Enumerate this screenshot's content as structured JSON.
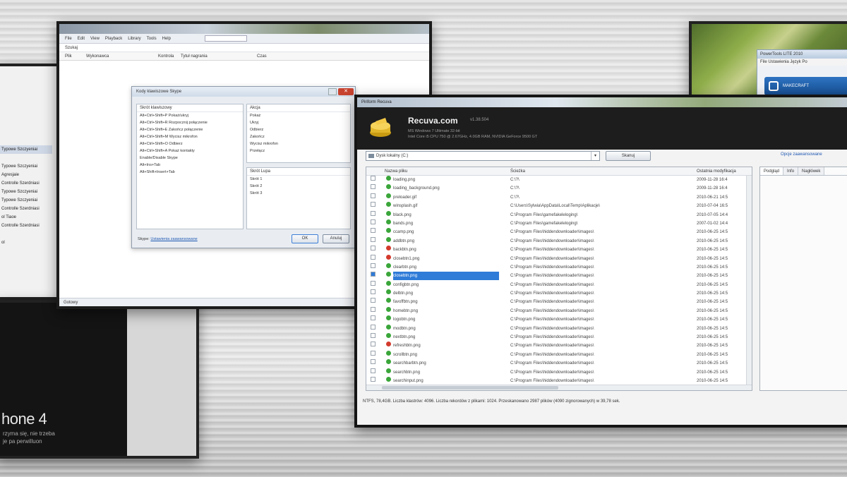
{
  "left_window": {
    "items": [
      "",
      "Typowe Szczyeniai",
      "",
      "Typowe Szczyeniai",
      "Agresjaie",
      "Controlle Szerdniasi",
      "Typowe Szczyeniai",
      "Typowe Szczyeniai",
      "Controlle Szerdniasi",
      "ol Tiaoe",
      "Controlle Szerdniasi",
      "",
      "ol"
    ]
  },
  "phone_window": {
    "title": "hone 4",
    "subtitle_1": "rzyma się, nie trzeba",
    "subtitle_2": "je pa perwilluon"
  },
  "forest_window": {
    "title": "PowerTools LITE 2010",
    "menu": "File   Ustawienia   Język   Po",
    "banner": "MAKECRAFT"
  },
  "media_window": {
    "menu": [
      "File",
      "Edit",
      "View",
      "Playback",
      "Library",
      "Tools",
      "Help"
    ],
    "address": "Szukaj",
    "columns": [
      "Plik",
      "Wykonawca",
      "Kontrola",
      "Tytuł nagrania",
      "Czas"
    ],
    "status": "Gotowy",
    "dialog": {
      "title": "Kody klawiszowe Skype",
      "left_caption": "Skrót klawiszowy",
      "left_items": [
        "Alt+Ctrl+Shift+P Pokaż/ukryj",
        "Alt+Ctrl+Shift+R Rozpocznij połączenie",
        "Alt+Ctrl+Shift+E Zakończ połączenie",
        "Alt+Ctrl+Shift+M Wycisz mikrofon",
        "Alt+Ctrl+Shift+O Odbierz",
        "Alt+Ctrl+Shift+A Pokaż kontakty",
        "Enable/Disable Skype",
        "Alt+Ins+Tab",
        "Alt+Shift+Insert+Tab"
      ],
      "right_caption": "Akcja",
      "right_items": [
        "Pokaż",
        "Ukryj",
        "Odbierz",
        "Zakończ",
        "Wycisz mikrofon",
        "Przełącz"
      ],
      "right2_caption": "Skrót Lupa",
      "right2_items": [
        "Skrót 1",
        "Skrót 2",
        "Skrót 3"
      ],
      "footer_text": "Skype:",
      "footer_link": "Ustawienia zaawansowane",
      "ok": "OK",
      "cancel": "Anuluj"
    }
  },
  "recuva": {
    "title": "Piriform Recuva",
    "brand": "Recuva.com",
    "version": "v1.38.504",
    "sys_1": "MS Windows 7 Ultimate 32-bit",
    "sys_2": "Intel Core i5 CPU 750 @ 2.67GHz, 4.0GB RAM, NVIDIA GeForce 9500 GT",
    "drive": "Dysk lokalny (C:)",
    "scan": "Skanuj",
    "advanced": "Opcje zaawansowane",
    "columns": [
      "Nazwa pliku",
      "Ścieżka",
      "Ostatnia modyfikacja"
    ],
    "rows": [
      {
        "name": "loading.png",
        "path": "C:\\?\\",
        "date": "2009-11-28 16:4",
        "state": "green",
        "selected": false
      },
      {
        "name": "loading_background.png",
        "path": "C:\\?\\",
        "date": "2009-11-28 16:4",
        "state": "green",
        "selected": false
      },
      {
        "name": "preloader.gif",
        "path": "C:\\?\\",
        "date": "2010-06-21 14:5",
        "state": "green",
        "selected": false
      },
      {
        "name": "winsplash.gif",
        "path": "C:\\Users\\Sylwia\\AppData\\Local\\Temp\\Aplikacje\\",
        "date": "2010-07-04 16:5",
        "state": "green",
        "selected": false
      },
      {
        "name": "black.png",
        "path": "C:\\Program Files\\gamefakeleloging\\",
        "date": "2010-07-05 14:4",
        "state": "green",
        "selected": false
      },
      {
        "name": "bands.png",
        "path": "C:\\Program Files\\gamefakeleloging\\",
        "date": "2007-01-02 14:4",
        "state": "green",
        "selected": false
      },
      {
        "name": "ccamp.png",
        "path": "C:\\Program Files\\hiddendownloader\\images\\",
        "date": "2010-06-25 14:5",
        "state": "green",
        "selected": false
      },
      {
        "name": "addbtn.png",
        "path": "C:\\Program Files\\hiddendownloader\\images\\",
        "date": "2010-06-25 14:5",
        "state": "green",
        "selected": false
      },
      {
        "name": "backbtn.png",
        "path": "C:\\Program Files\\hiddendownloader\\images\\",
        "date": "2010-06-25 14:5",
        "state": "red",
        "selected": false
      },
      {
        "name": "closebtn1.png",
        "path": "C:\\Program Files\\hiddendownloader\\images\\",
        "date": "2010-06-25 14:5",
        "state": "red",
        "selected": false
      },
      {
        "name": "clearbtn.png",
        "path": "C:\\Program Files\\hiddendownloader\\images\\",
        "date": "2010-06-25 14:5",
        "state": "green",
        "selected": false
      },
      {
        "name": "closebtn.png",
        "path": "C:\\Program Files\\hiddendownloader\\images\\",
        "date": "2010-06-25 14:5",
        "state": "green",
        "selected": true
      },
      {
        "name": "configbtn.png",
        "path": "C:\\Program Files\\hiddendownloader\\images\\",
        "date": "2010-06-25 14:5",
        "state": "green",
        "selected": false
      },
      {
        "name": "delbtn.png",
        "path": "C:\\Program Files\\hiddendownloader\\images\\",
        "date": "2010-06-25 14:5",
        "state": "green",
        "selected": false
      },
      {
        "name": "favoffbtn.png",
        "path": "C:\\Program Files\\hiddendownloader\\images\\",
        "date": "2010-06-25 14:5",
        "state": "green",
        "selected": false
      },
      {
        "name": "homebtn.png",
        "path": "C:\\Program Files\\hiddendownloader\\images\\",
        "date": "2010-06-25 14:5",
        "state": "green",
        "selected": false
      },
      {
        "name": "logobtn.png",
        "path": "C:\\Program Files\\hiddendownloader\\images\\",
        "date": "2010-06-25 14:5",
        "state": "green",
        "selected": false
      },
      {
        "name": "modbtn.png",
        "path": "C:\\Program Files\\hiddendownloader\\images\\",
        "date": "2010-06-25 14:5",
        "state": "green",
        "selected": false
      },
      {
        "name": "nextbtn.png",
        "path": "C:\\Program Files\\hiddendownloader\\images\\",
        "date": "2010-06-25 14:5",
        "state": "green",
        "selected": false
      },
      {
        "name": "refreshbtn.png",
        "path": "C:\\Program Files\\hiddendownloader\\images\\",
        "date": "2010-06-25 14:5",
        "state": "red",
        "selected": false
      },
      {
        "name": "scrollbtn.png",
        "path": "C:\\Program Files\\hiddendownloader\\images\\",
        "date": "2010-06-25 14:5",
        "state": "green",
        "selected": false
      },
      {
        "name": "searchbarbtn.png",
        "path": "C:\\Program Files\\hiddendownloader\\images\\",
        "date": "2010-06-25 14:5",
        "state": "green",
        "selected": false
      },
      {
        "name": "searchbtn.png",
        "path": "C:\\Program Files\\hiddendownloader\\images\\",
        "date": "2010-06-25 14:5",
        "state": "green",
        "selected": false
      },
      {
        "name": "searchinput.png",
        "path": "C:\\Program Files\\hiddendownloader\\images\\",
        "date": "2010-06-25 14:5",
        "state": "green",
        "selected": false
      }
    ],
    "tabs": [
      "Podgląd",
      "Info",
      "Nagłówek"
    ],
    "status": "NTFS, 78,4GB. Liczba klastrów: 4096. Liczba rekordów z plikami: 1024. Przeskanowano 2987 plików (4090 zignorowanych) w 39,78 sek."
  },
  "colors": {
    "state_green": "#3aa63a",
    "state_red": "#d33a2c",
    "selection": "#2f7bd8",
    "header_dark": "#1d1d1d"
  }
}
